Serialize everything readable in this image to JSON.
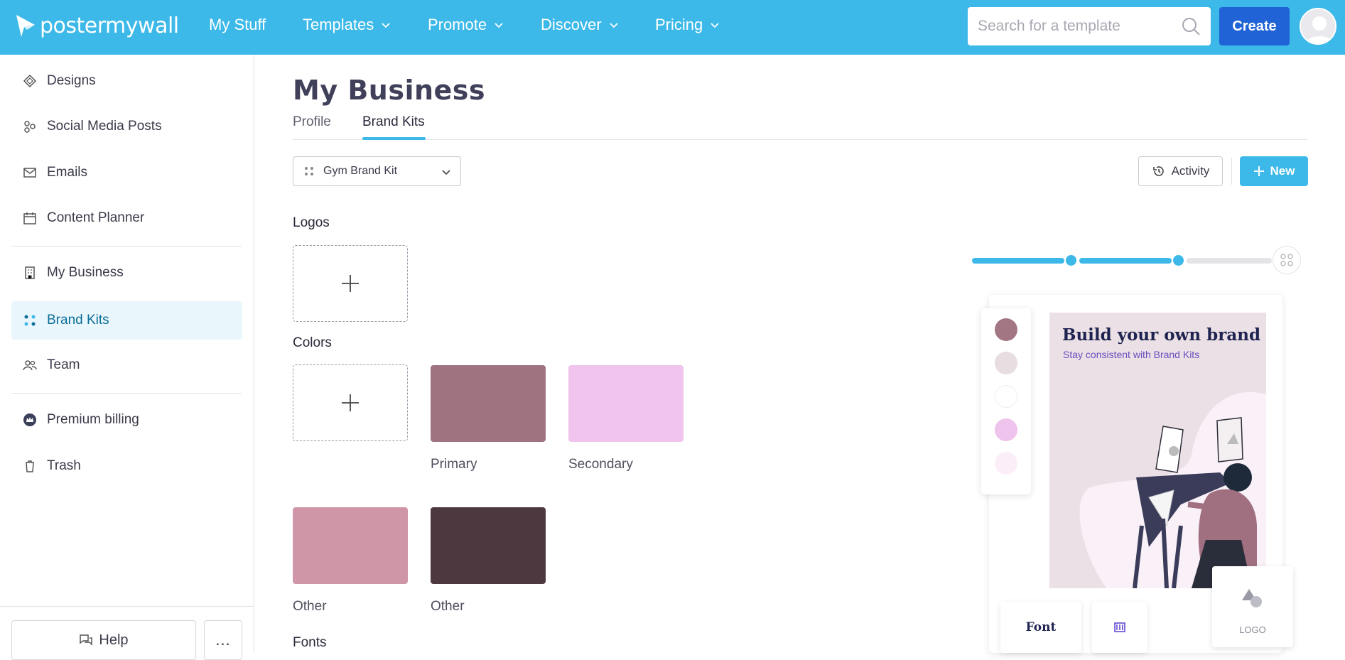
{
  "brand": {
    "logo_text": "postermywall"
  },
  "topnav": {
    "items": [
      {
        "label": "My Stuff",
        "has_menu": false
      },
      {
        "label": "Templates",
        "has_menu": true
      },
      {
        "label": "Promote",
        "has_menu": true
      },
      {
        "label": "Discover",
        "has_menu": true
      },
      {
        "label": "Pricing",
        "has_menu": true
      }
    ],
    "search_placeholder": "Search for a template",
    "create_label": "Create"
  },
  "sidebar": {
    "items": [
      {
        "label": "Designs",
        "icon": "designs-icon"
      },
      {
        "label": "Social Media Posts",
        "icon": "social-media-icon"
      },
      {
        "label": "Emails",
        "icon": "email-icon"
      },
      {
        "label": "Content Planner",
        "icon": "calendar-icon"
      },
      {
        "label": "My Business",
        "icon": "building-icon"
      },
      {
        "label": "Brand Kits",
        "icon": "brand-kits-icon",
        "active": true
      },
      {
        "label": "Team",
        "icon": "team-icon"
      },
      {
        "label": "Premium billing",
        "icon": "crown-icon"
      },
      {
        "label": "Trash",
        "icon": "trash-icon"
      }
    ],
    "help_label": "Help",
    "more_label": "..."
  },
  "main": {
    "title": "My Business",
    "tabs": [
      {
        "label": "Profile",
        "active": false
      },
      {
        "label": "Brand Kits",
        "active": true
      }
    ],
    "kit_select": {
      "value": "Gym Brand Kit"
    },
    "activity_label": "Activity",
    "new_label": "New",
    "sections": {
      "logos": "Logos",
      "colors": "Colors",
      "fonts": "Fonts"
    },
    "colors": [
      {
        "label": "Primary",
        "hex": "#9f7480"
      },
      {
        "label": "Secondary",
        "hex": "#f0c4ec"
      },
      {
        "label": "Other",
        "hex": "#ce96a6"
      },
      {
        "label": "Other",
        "hex": "#4d3840"
      }
    ]
  },
  "progress": {
    "steps_completed": 2,
    "steps_total": 3
  },
  "preview": {
    "title": "Build your own brand",
    "subtitle": "Stay consistent with Brand Kits",
    "strip_colors": [
      "#a27682",
      "#e8dde1",
      "#ffffff",
      "#eec3ec",
      "#fbeef8"
    ],
    "font_tile_label": "Font",
    "logo_tile_label": "LOGO"
  },
  "colors_theme": {
    "accent": "#3cb9e8",
    "create_button": "#1f63d6"
  }
}
